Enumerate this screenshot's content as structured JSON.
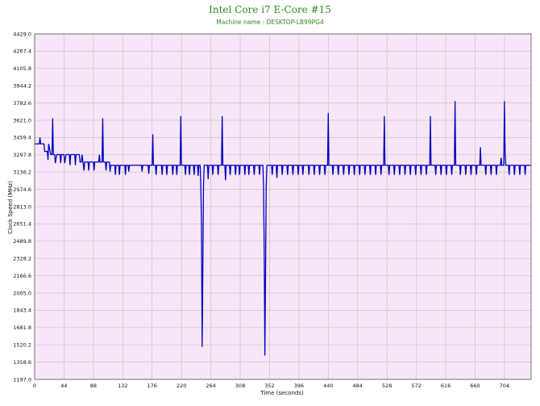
{
  "chart_data": {
    "type": "line",
    "title": "Intel Core i7 E-Core #15",
    "subtitle": "Machine name : DESKTOP-LB99PG4",
    "xlabel": "Time (seconds)",
    "ylabel": "Clock Speed (MHz)",
    "xlim": [
      0,
      744
    ],
    "ylim": [
      1197.0,
      4429.0
    ],
    "x_ticks": [
      "0",
      "44",
      "88",
      "132",
      "176",
      "220",
      "264",
      "308",
      "352",
      "396",
      "440",
      "484",
      "528",
      "572",
      "616",
      "660",
      "704"
    ],
    "y_ticks": [
      "1197.0",
      "1358.6",
      "1520.2",
      "1681.8",
      "1843.4",
      "2005.0",
      "2166.6",
      "2328.2",
      "2489.8",
      "2651.4",
      "2813.0",
      "2974.6",
      "3136.2",
      "3297.8",
      "3459.4",
      "3621.0",
      "3782.6",
      "3944.2",
      "4105.8",
      "4267.4",
      "4429.0"
    ],
    "grid": true,
    "background_color": "#f7e6f7",
    "grid_color": "#c4c4c4",
    "line_color": "#0000c0",
    "title_color": "#2e8b22",
    "series": [
      {
        "points": [
          [
            0,
            3400
          ],
          [
            7,
            3400
          ],
          [
            8,
            3460
          ],
          [
            9,
            3400
          ],
          [
            14,
            3400
          ],
          [
            15,
            3330
          ],
          [
            19,
            3330
          ],
          [
            20,
            3250
          ],
          [
            21,
            3400
          ],
          [
            24,
            3300
          ],
          [
            26,
            3300
          ],
          [
            27,
            3640
          ],
          [
            28,
            3300
          ],
          [
            30,
            3300
          ],
          [
            31,
            3220
          ],
          [
            33,
            3300
          ],
          [
            38,
            3300
          ],
          [
            39,
            3220
          ],
          [
            40,
            3300
          ],
          [
            44,
            3300
          ],
          [
            45,
            3220
          ],
          [
            47,
            3300
          ],
          [
            52,
            3300
          ],
          [
            53,
            3200
          ],
          [
            54,
            3300
          ],
          [
            60,
            3300
          ],
          [
            61,
            3200
          ],
          [
            62,
            3300
          ],
          [
            66,
            3300
          ],
          [
            67,
            3300
          ],
          [
            68,
            3230
          ],
          [
            70,
            3230
          ],
          [
            71,
            3300
          ],
          [
            74,
            3150
          ],
          [
            75,
            3230
          ],
          [
            80,
            3230
          ],
          [
            81,
            3150
          ],
          [
            82,
            3230
          ],
          [
            88,
            3230
          ],
          [
            89,
            3150
          ],
          [
            90,
            3230
          ],
          [
            96,
            3230
          ],
          [
            97,
            3300
          ],
          [
            98,
            3230
          ],
          [
            101,
            3230
          ],
          [
            102,
            3640
          ],
          [
            103,
            3230
          ],
          [
            106,
            3230
          ],
          [
            107,
            3150
          ],
          [
            108,
            3230
          ],
          [
            112,
            3230
          ],
          [
            113,
            3140
          ],
          [
            114,
            3200
          ],
          [
            120,
            3200
          ],
          [
            121,
            3110
          ],
          [
            122,
            3200
          ],
          [
            126,
            3200
          ],
          [
            127,
            3110
          ],
          [
            128,
            3200
          ],
          [
            135,
            3200
          ],
          [
            136,
            3110
          ],
          [
            137,
            3200
          ],
          [
            140,
            3200
          ],
          [
            141,
            3140
          ],
          [
            142,
            3200
          ],
          [
            160,
            3200
          ],
          [
            161,
            3140
          ],
          [
            162,
            3200
          ],
          [
            170,
            3200
          ],
          [
            171,
            3120
          ],
          [
            172,
            3200
          ],
          [
            176,
            3200
          ],
          [
            177,
            3490
          ],
          [
            178,
            3200
          ],
          [
            181,
            3200
          ],
          [
            182,
            3110
          ],
          [
            183,
            3200
          ],
          [
            190,
            3200
          ],
          [
            191,
            3110
          ],
          [
            192,
            3200
          ],
          [
            197,
            3200
          ],
          [
            198,
            3110
          ],
          [
            199,
            3200
          ],
          [
            206,
            3200
          ],
          [
            207,
            3110
          ],
          [
            208,
            3200
          ],
          [
            212,
            3200
          ],
          [
            213,
            3110
          ],
          [
            214,
            3200
          ],
          [
            218,
            3200
          ],
          [
            219,
            3660
          ],
          [
            220,
            3200
          ],
          [
            225,
            3200
          ],
          [
            226,
            3110
          ],
          [
            227,
            3200
          ],
          [
            231,
            3200
          ],
          [
            232,
            3110
          ],
          [
            233,
            3200
          ],
          [
            238,
            3200
          ],
          [
            239,
            3110
          ],
          [
            240,
            3200
          ],
          [
            244,
            3200
          ],
          [
            245,
            3100
          ],
          [
            246,
            3200
          ],
          [
            248,
            3200
          ],
          [
            249,
            3000
          ],
          [
            250,
            2650
          ],
          [
            251,
            1500
          ],
          [
            252,
            2200
          ],
          [
            253,
            3000
          ],
          [
            254,
            3200
          ],
          [
            259,
            3200
          ],
          [
            260,
            3070
          ],
          [
            261,
            3200
          ],
          [
            266,
            3200
          ],
          [
            267,
            3110
          ],
          [
            268,
            3200
          ],
          [
            274,
            3200
          ],
          [
            275,
            3110
          ],
          [
            276,
            3200
          ],
          [
            280,
            3200
          ],
          [
            281,
            3660
          ],
          [
            282,
            3200
          ],
          [
            285,
            3200
          ],
          [
            286,
            3060
          ],
          [
            287,
            3200
          ],
          [
            292,
            3200
          ],
          [
            293,
            3110
          ],
          [
            294,
            3200
          ],
          [
            300,
            3200
          ],
          [
            301,
            3110
          ],
          [
            302,
            3200
          ],
          [
            306,
            3200
          ],
          [
            307,
            3110
          ],
          [
            308,
            3200
          ],
          [
            314,
            3200
          ],
          [
            315,
            3110
          ],
          [
            316,
            3200
          ],
          [
            320,
            3200
          ],
          [
            321,
            3110
          ],
          [
            322,
            3200
          ],
          [
            328,
            3200
          ],
          [
            329,
            3110
          ],
          [
            330,
            3200
          ],
          [
            336,
            3200
          ],
          [
            337,
            3110
          ],
          [
            338,
            3200
          ],
          [
            342,
            3200
          ],
          [
            343,
            3000
          ],
          [
            344,
            2400
          ],
          [
            345,
            1420
          ],
          [
            346,
            2200
          ],
          [
            347,
            3000
          ],
          [
            348,
            3200
          ],
          [
            355,
            3200
          ],
          [
            356,
            3110
          ],
          [
            357,
            3200
          ],
          [
            362,
            3200
          ],
          [
            363,
            3080
          ],
          [
            364,
            3200
          ],
          [
            370,
            3200
          ],
          [
            371,
            3110
          ],
          [
            372,
            3200
          ],
          [
            378,
            3200
          ],
          [
            379,
            3110
          ],
          [
            380,
            3200
          ],
          [
            386,
            3200
          ],
          [
            387,
            3110
          ],
          [
            388,
            3200
          ],
          [
            394,
            3200
          ],
          [
            395,
            3110
          ],
          [
            396,
            3200
          ],
          [
            401,
            3200
          ],
          [
            402,
            3110
          ],
          [
            403,
            3200
          ],
          [
            410,
            3200
          ],
          [
            411,
            3110
          ],
          [
            412,
            3200
          ],
          [
            418,
            3200
          ],
          [
            419,
            3110
          ],
          [
            420,
            3200
          ],
          [
            426,
            3200
          ],
          [
            427,
            3110
          ],
          [
            428,
            3200
          ],
          [
            434,
            3200
          ],
          [
            435,
            3110
          ],
          [
            436,
            3200
          ],
          [
            439,
            3200
          ],
          [
            440,
            3690
          ],
          [
            441,
            3200
          ],
          [
            446,
            3200
          ],
          [
            447,
            3110
          ],
          [
            448,
            3200
          ],
          [
            454,
            3200
          ],
          [
            455,
            3110
          ],
          [
            456,
            3200
          ],
          [
            462,
            3200
          ],
          [
            463,
            3110
          ],
          [
            464,
            3200
          ],
          [
            470,
            3200
          ],
          [
            471,
            3110
          ],
          [
            472,
            3200
          ],
          [
            478,
            3200
          ],
          [
            479,
            3110
          ],
          [
            480,
            3200
          ],
          [
            486,
            3200
          ],
          [
            487,
            3110
          ],
          [
            488,
            3200
          ],
          [
            494,
            3200
          ],
          [
            495,
            3110
          ],
          [
            496,
            3200
          ],
          [
            502,
            3200
          ],
          [
            503,
            3110
          ],
          [
            504,
            3200
          ],
          [
            510,
            3200
          ],
          [
            511,
            3110
          ],
          [
            512,
            3200
          ],
          [
            518,
            3200
          ],
          [
            519,
            3110
          ],
          [
            520,
            3200
          ],
          [
            523,
            3200
          ],
          [
            524,
            3660
          ],
          [
            525,
            3200
          ],
          [
            530,
            3200
          ],
          [
            531,
            3110
          ],
          [
            532,
            3200
          ],
          [
            538,
            3200
          ],
          [
            539,
            3110
          ],
          [
            540,
            3200
          ],
          [
            546,
            3200
          ],
          [
            547,
            3110
          ],
          [
            548,
            3200
          ],
          [
            554,
            3200
          ],
          [
            555,
            3110
          ],
          [
            556,
            3200
          ],
          [
            562,
            3200
          ],
          [
            563,
            3110
          ],
          [
            564,
            3200
          ],
          [
            570,
            3200
          ],
          [
            571,
            3110
          ],
          [
            572,
            3200
          ],
          [
            578,
            3200
          ],
          [
            579,
            3110
          ],
          [
            580,
            3200
          ],
          [
            586,
            3200
          ],
          [
            587,
            3110
          ],
          [
            588,
            3200
          ],
          [
            592,
            3200
          ],
          [
            593,
            3660
          ],
          [
            594,
            3200
          ],
          [
            600,
            3200
          ],
          [
            601,
            3110
          ],
          [
            602,
            3200
          ],
          [
            608,
            3200
          ],
          [
            609,
            3110
          ],
          [
            610,
            3200
          ],
          [
            616,
            3200
          ],
          [
            617,
            3110
          ],
          [
            618,
            3200
          ],
          [
            624,
            3200
          ],
          [
            625,
            3110
          ],
          [
            626,
            3200
          ],
          [
            629,
            3200
          ],
          [
            630,
            3800
          ],
          [
            631,
            3200
          ],
          [
            637,
            3200
          ],
          [
            638,
            3110
          ],
          [
            639,
            3200
          ],
          [
            645,
            3200
          ],
          [
            646,
            3110
          ],
          [
            647,
            3200
          ],
          [
            653,
            3200
          ],
          [
            654,
            3110
          ],
          [
            655,
            3200
          ],
          [
            661,
            3200
          ],
          [
            662,
            3110
          ],
          [
            663,
            3200
          ],
          [
            667,
            3200
          ],
          [
            668,
            3370
          ],
          [
            669,
            3200
          ],
          [
            675,
            3200
          ],
          [
            676,
            3110
          ],
          [
            677,
            3200
          ],
          [
            683,
            3200
          ],
          [
            684,
            3110
          ],
          [
            685,
            3200
          ],
          [
            691,
            3200
          ],
          [
            692,
            3110
          ],
          [
            693,
            3200
          ],
          [
            698,
            3200
          ],
          [
            699,
            3270
          ],
          [
            700,
            3200
          ],
          [
            703,
            3200
          ],
          [
            704,
            3800
          ],
          [
            705,
            3320
          ],
          [
            706,
            3200
          ],
          [
            710,
            3200
          ],
          [
            711,
            3110
          ],
          [
            712,
            3200
          ],
          [
            718,
            3200
          ],
          [
            719,
            3110
          ],
          [
            720,
            3200
          ],
          [
            726,
            3200
          ],
          [
            727,
            3110
          ],
          [
            728,
            3200
          ],
          [
            734,
            3200
          ],
          [
            735,
            3110
          ],
          [
            736,
            3200
          ],
          [
            744,
            3200
          ]
        ]
      }
    ]
  }
}
